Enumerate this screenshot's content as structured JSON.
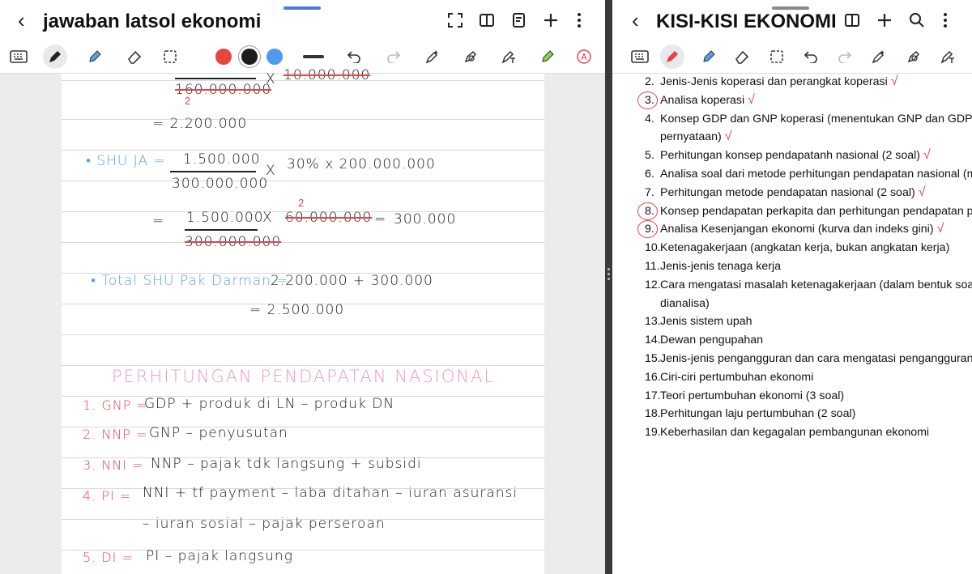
{
  "left": {
    "title": "jawaban latsol ekonomi",
    "colors": [
      "#e8453c",
      "#1c1c1c",
      "#4f9aee"
    ],
    "note": {
      "frac1_den": "160.000.000",
      "frac1_den_fix": "2",
      "frac1_x": "X",
      "frac1_rest": "10.000.000",
      "line1": "=  2.200.000",
      "shu_label": "• SHU JA =",
      "shu_num": "1.500.000",
      "shu_den": "300.000.000",
      "shu_x": "X",
      "shu_rest": "30% x 200.000.000",
      "eq2": "=",
      "eq2_num": "1.500.000",
      "eq2_x": "X",
      "eq2_fix": "2",
      "eq2_strike": "60.000.000",
      "eq2_eq": "=",
      "eq2_result": "300.000",
      "eq2_den": "300.000.000",
      "total_label": "• Total SHU Pak Darman =",
      "total_expr": "2.200.000 + 300.000",
      "total_eq": "=  2.500.000",
      "heading": "PERHITUNGAN PENDAPATAN NASIONAL",
      "items": [
        {
          "label": "1. GNP =",
          "text": "GDP + produk di LN – produk DN"
        },
        {
          "label": "2. NNP =",
          "text": "GNP – penyusutan"
        },
        {
          "label": "3. NNI =",
          "text": "NNP – pajak tdk langsung + subsidi"
        },
        {
          "label": "4. PI  =",
          "text": "NNI + tf payment – laba ditahan – iuran asuransi"
        },
        {
          "label": "",
          "text": "– iuran sosial – pajak perseroan"
        },
        {
          "label": "5. DI  =",
          "text": "PI – pajak langsung"
        }
      ]
    }
  },
  "right": {
    "title": "KISI-KISI EKONOMI",
    "list": [
      {
        "num": "2.",
        "text": "Jenis-Jenis koperasi dan perangkat koperasi",
        "check": "√",
        "circled": false
      },
      {
        "num": "3.",
        "text": "Analisa koperasi",
        "check": "√",
        "circled": true
      },
      {
        "num": "4.",
        "text": "Konsep GDP dan GNP koperasi (menentukan GNP dan GDP dari",
        "text2": "pernyataan)",
        "check": "√",
        "circled": false
      },
      {
        "num": "5.",
        "text": "Perhitungan konsep pendapatanh nasional (2 soal)",
        "check": "√",
        "circled": false
      },
      {
        "num": "6.",
        "text": "Analisa soal dari metode perhitungan pendapatan nasional (metode",
        "check": "",
        "circled": false
      },
      {
        "num": "7.",
        "text": "Perhitungan metode pendapatan nasional (2 soal)",
        "check": "√",
        "circled": false
      },
      {
        "num": "8.",
        "text": "Konsep pendapatan perkapita dan perhitungan pendapatan perkapita",
        "check": "",
        "circled": true
      },
      {
        "num": "9.",
        "text": "Analisa Kesenjangan ekonomi (kurva dan indeks gini)",
        "check": "√",
        "circled": true
      },
      {
        "num": "10.",
        "text": "Ketenagakerjaan (angkatan kerja, bukan angkatan kerja)",
        "check": "",
        "circled": false
      },
      {
        "num": "11.",
        "text": "Jenis-jenis tenaga kerja",
        "check": "",
        "circled": false
      },
      {
        "num": "12.",
        "text": "Cara mengatasi masalah ketenagakerjaan (dalam bentuk soal per",
        "text2": "dianalisa)",
        "check": "",
        "circled": false
      },
      {
        "num": "13.",
        "text": "Jenis sistem upah",
        "check": "",
        "circled": false
      },
      {
        "num": "14.",
        "text": "Dewan pengupahan",
        "check": "",
        "circled": false
      },
      {
        "num": "15.",
        "text": "Jenis-jenis pengangguran dan cara mengatasi pengangguran",
        "check": "",
        "circled": false
      },
      {
        "num": "16.",
        "text": "Ciri-ciri pertumbuhan ekonomi",
        "check": "",
        "circled": false
      },
      {
        "num": "17.",
        "text": "Teori pertumbuhan ekonomi (3 soal)",
        "check": "",
        "circled": false
      },
      {
        "num": "18.",
        "text": "Perhitungan laju pertumbuhan (2 soal)",
        "check": "",
        "circled": false
      },
      {
        "num": "19.",
        "text": "Keberhasilan dan kegagalan pembangunan ekonomi",
        "check": "",
        "circled": false
      }
    ]
  }
}
